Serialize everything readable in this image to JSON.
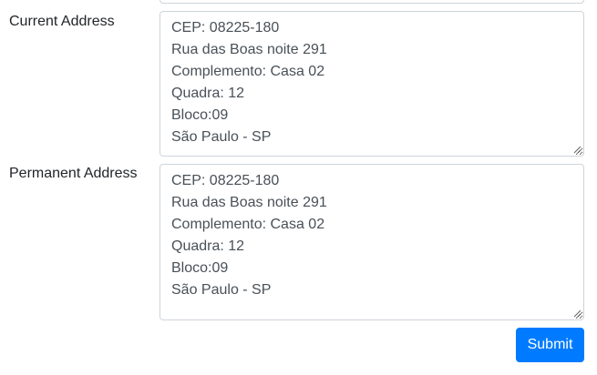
{
  "form": {
    "current_address": {
      "label": "Current Address",
      "lines": [
        "CEP: 08225-180",
        "Rua das Boas noite 291",
        "Complemento: Casa 02",
        "Quadra: 12",
        "Bloco:09",
        "São Paulo - SP"
      ]
    },
    "permanent_address": {
      "label": "Permanent Address",
      "lines": [
        "CEP: 08225-180",
        "Rua das Boas noite 291",
        "Complemento: Casa 02",
        "Quadra: 12",
        "Bloco:09",
        "São Paulo - SP"
      ]
    },
    "submit_label": "Submit"
  },
  "colors": {
    "primary": "#007bff",
    "border": "#ced4da",
    "text": "#212529"
  },
  "icons": {
    "resize": "resize-grip-icon"
  }
}
